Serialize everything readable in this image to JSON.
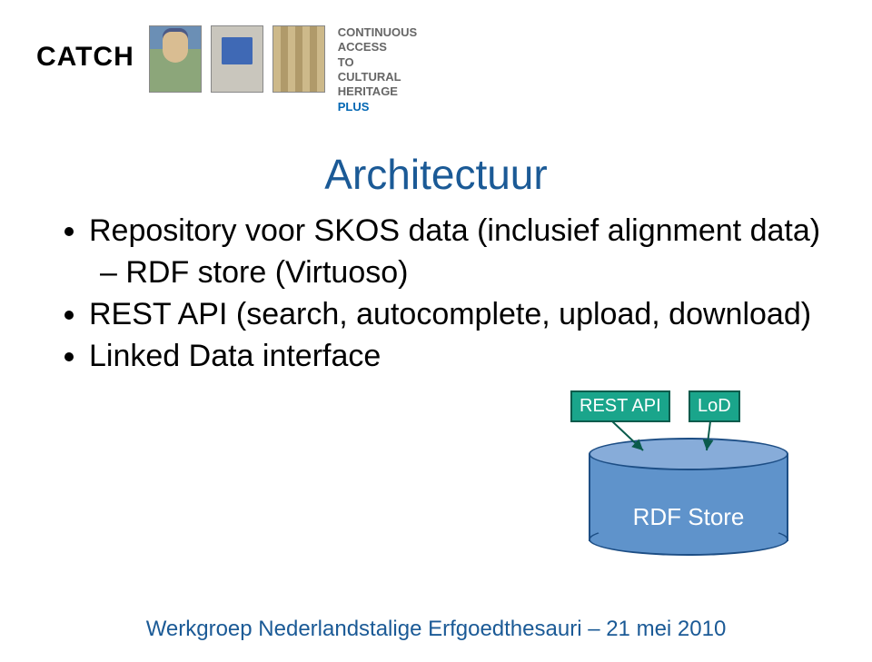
{
  "header": {
    "logo_text": "CATCH",
    "plus_lines": [
      "CONTINUOUS",
      "ACCESS",
      "TO",
      "CULTURAL",
      "HERITAGE"
    ],
    "plus_label": "PLUS"
  },
  "title": "Architectuur",
  "bullets": {
    "item1": "Repository voor SKOS data (inclusief alignment data)",
    "item1_sub1": "RDF store (Virtuoso)",
    "item2": "REST API (search, autocomplete, upload, download)",
    "item3": "Linked Data interface"
  },
  "diagram": {
    "box_rest": "REST API",
    "box_lod": "LoD",
    "cylinder_label": "RDF Store"
  },
  "footer": "Werkgroep Nederlandstalige Erfgoedthesauri – 21 mei 2010"
}
